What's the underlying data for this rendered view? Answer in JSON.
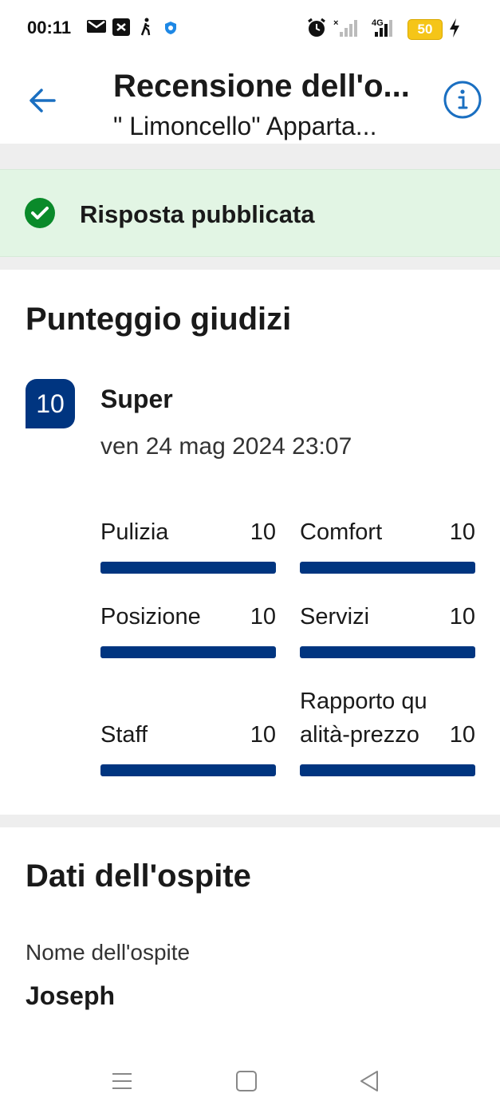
{
  "status_bar": {
    "time": "00:11",
    "battery": "50",
    "network": "4G",
    "icons": [
      "mail-icon",
      "notification-icon",
      "walk-icon",
      "shield-icon",
      "alarm-icon",
      "signal-icon",
      "battery-icon",
      "charging-icon"
    ]
  },
  "header": {
    "title": "Recensione dell'o...",
    "subtitle": "\" Limoncello\" Apparta...",
    "back_icon": "arrow-left-icon",
    "info_icon": "info-icon",
    "accent": "#1a6fc1"
  },
  "banner": {
    "text": "Risposta pubblicata",
    "icon": "check-circle-icon",
    "background": "#e2f5e4",
    "icon_color": "#0a8a2a"
  },
  "scores": {
    "heading": "Punteggio giudizi",
    "overall": "10",
    "overall_word": "Super",
    "date": "ven 24 mag 2024 23:07",
    "badge_color": "#003580",
    "categories": [
      {
        "label": "Pulizia",
        "value": "10",
        "fill": 1.0
      },
      {
        "label": "Comfort",
        "value": "10",
        "fill": 1.0
      },
      {
        "label": "Posizione",
        "value": "10",
        "fill": 1.0
      },
      {
        "label": "Servizi",
        "value": "10",
        "fill": 1.0
      },
      {
        "label": "Staff",
        "value": "10",
        "fill": 1.0
      },
      {
        "label": "Rapporto qu alità-prezzo",
        "value": "10",
        "fill": 1.0
      }
    ]
  },
  "guest": {
    "heading": "Dati dell'ospite",
    "name_label": "Nome dell'ospite",
    "name": "Joseph"
  },
  "nav": {
    "icons": [
      "menu-icon",
      "home-icon",
      "back-icon"
    ]
  }
}
